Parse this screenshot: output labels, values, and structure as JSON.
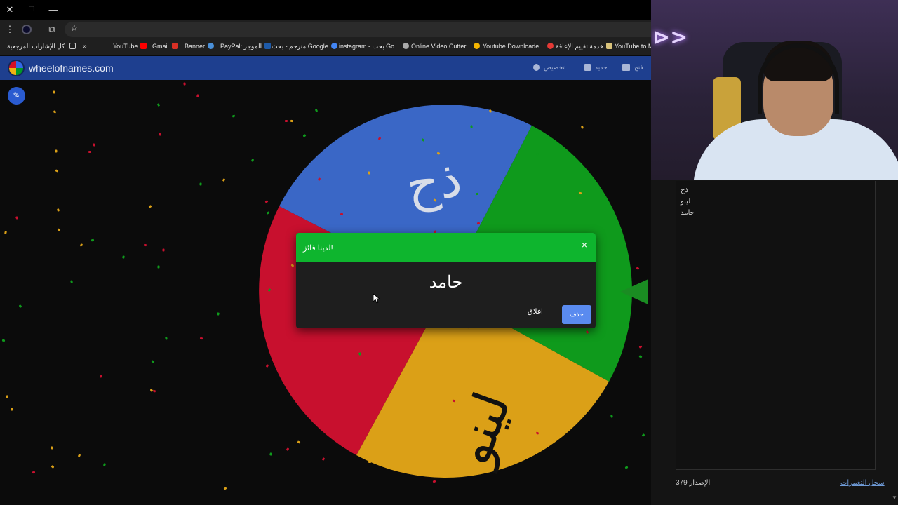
{
  "window": {
    "close": "✕",
    "restore": "❐",
    "minimize": "—"
  },
  "toolbar": {
    "menu": "⋮",
    "extensions": "⧉",
    "bookmark_star": "☆"
  },
  "bookmarks": {
    "all_bookmarks": "كل الإشارات المرجعية",
    "more": "»",
    "items": [
      {
        "label": "YouTube",
        "color": "#ff0000"
      },
      {
        "label": "Gmail",
        "color": "#d93025"
      },
      {
        "label": "Banner",
        "color": "#4a90d9"
      },
      {
        "label": "PayPal: الموجز",
        "color": "#1e5aa8"
      },
      {
        "label": "مترجم - بحث Google",
        "color": "#4285f4"
      },
      {
        "label": "instagram - بحث Go...",
        "color": "#aaaaaa"
      },
      {
        "label": "Online Video Cutter...",
        "color": "#f4b400"
      },
      {
        "label": "Youtube Downloade...",
        "color": "#e53935"
      },
      {
        "label": "خدمة تقييم الإعاقة",
        "color": "#d8c27a"
      },
      {
        "label": "YouTube to Mp",
        "color": "#ffffff"
      }
    ]
  },
  "app": {
    "site_title": "wheelofnames.com",
    "nav": {
      "customize": "تخصيص",
      "new": "جديد",
      "open": "فتح"
    }
  },
  "wheel": {
    "colors": {
      "blue": "#3a67c6",
      "green": "#0f9a1c",
      "yellow": "#dba017",
      "red": "#c8102e"
    },
    "labels": [
      "ذح",
      "لينو"
    ]
  },
  "dialog": {
    "title": "لدينا فائز!",
    "close_icon": "×",
    "winner": "حامد",
    "close_button": "اغلاق",
    "remove_button": "حذف",
    "header_color": "#0eb52e",
    "button_color": "#5a8bef"
  },
  "panel": {
    "entries": [
      "ذح",
      "لينو",
      "حامد"
    ],
    "version_label": "الإصدار 379",
    "results_link": "سجل التغييرات"
  }
}
